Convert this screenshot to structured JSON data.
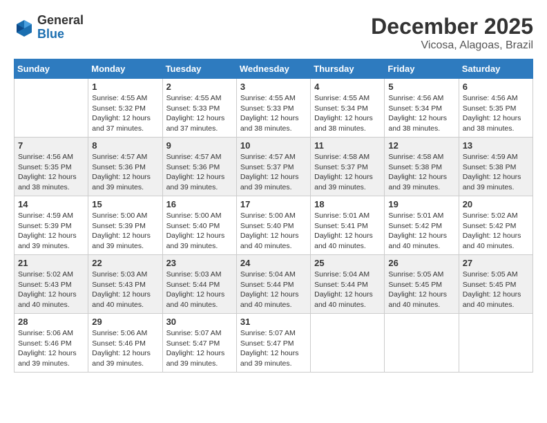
{
  "logo": {
    "general": "General",
    "blue": "Blue"
  },
  "title": "December 2025",
  "location": "Vicosa, Alagoas, Brazil",
  "days_of_week": [
    "Sunday",
    "Monday",
    "Tuesday",
    "Wednesday",
    "Thursday",
    "Friday",
    "Saturday"
  ],
  "weeks": [
    [
      {
        "day": "",
        "info": ""
      },
      {
        "day": "1",
        "info": "Sunrise: 4:55 AM\nSunset: 5:32 PM\nDaylight: 12 hours\nand 37 minutes."
      },
      {
        "day": "2",
        "info": "Sunrise: 4:55 AM\nSunset: 5:33 PM\nDaylight: 12 hours\nand 37 minutes."
      },
      {
        "day": "3",
        "info": "Sunrise: 4:55 AM\nSunset: 5:33 PM\nDaylight: 12 hours\nand 38 minutes."
      },
      {
        "day": "4",
        "info": "Sunrise: 4:55 AM\nSunset: 5:34 PM\nDaylight: 12 hours\nand 38 minutes."
      },
      {
        "day": "5",
        "info": "Sunrise: 4:56 AM\nSunset: 5:34 PM\nDaylight: 12 hours\nand 38 minutes."
      },
      {
        "day": "6",
        "info": "Sunrise: 4:56 AM\nSunset: 5:35 PM\nDaylight: 12 hours\nand 38 minutes."
      }
    ],
    [
      {
        "day": "7",
        "info": "Sunrise: 4:56 AM\nSunset: 5:35 PM\nDaylight: 12 hours\nand 38 minutes."
      },
      {
        "day": "8",
        "info": "Sunrise: 4:57 AM\nSunset: 5:36 PM\nDaylight: 12 hours\nand 39 minutes."
      },
      {
        "day": "9",
        "info": "Sunrise: 4:57 AM\nSunset: 5:36 PM\nDaylight: 12 hours\nand 39 minutes."
      },
      {
        "day": "10",
        "info": "Sunrise: 4:57 AM\nSunset: 5:37 PM\nDaylight: 12 hours\nand 39 minutes."
      },
      {
        "day": "11",
        "info": "Sunrise: 4:58 AM\nSunset: 5:37 PM\nDaylight: 12 hours\nand 39 minutes."
      },
      {
        "day": "12",
        "info": "Sunrise: 4:58 AM\nSunset: 5:38 PM\nDaylight: 12 hours\nand 39 minutes."
      },
      {
        "day": "13",
        "info": "Sunrise: 4:59 AM\nSunset: 5:38 PM\nDaylight: 12 hours\nand 39 minutes."
      }
    ],
    [
      {
        "day": "14",
        "info": "Sunrise: 4:59 AM\nSunset: 5:39 PM\nDaylight: 12 hours\nand 39 minutes."
      },
      {
        "day": "15",
        "info": "Sunrise: 5:00 AM\nSunset: 5:39 PM\nDaylight: 12 hours\nand 39 minutes."
      },
      {
        "day": "16",
        "info": "Sunrise: 5:00 AM\nSunset: 5:40 PM\nDaylight: 12 hours\nand 39 minutes."
      },
      {
        "day": "17",
        "info": "Sunrise: 5:00 AM\nSunset: 5:40 PM\nDaylight: 12 hours\nand 40 minutes."
      },
      {
        "day": "18",
        "info": "Sunrise: 5:01 AM\nSunset: 5:41 PM\nDaylight: 12 hours\nand 40 minutes."
      },
      {
        "day": "19",
        "info": "Sunrise: 5:01 AM\nSunset: 5:42 PM\nDaylight: 12 hours\nand 40 minutes."
      },
      {
        "day": "20",
        "info": "Sunrise: 5:02 AM\nSunset: 5:42 PM\nDaylight: 12 hours\nand 40 minutes."
      }
    ],
    [
      {
        "day": "21",
        "info": "Sunrise: 5:02 AM\nSunset: 5:43 PM\nDaylight: 12 hours\nand 40 minutes."
      },
      {
        "day": "22",
        "info": "Sunrise: 5:03 AM\nSunset: 5:43 PM\nDaylight: 12 hours\nand 40 minutes."
      },
      {
        "day": "23",
        "info": "Sunrise: 5:03 AM\nSunset: 5:44 PM\nDaylight: 12 hours\nand 40 minutes."
      },
      {
        "day": "24",
        "info": "Sunrise: 5:04 AM\nSunset: 5:44 PM\nDaylight: 12 hours\nand 40 minutes."
      },
      {
        "day": "25",
        "info": "Sunrise: 5:04 AM\nSunset: 5:44 PM\nDaylight: 12 hours\nand 40 minutes."
      },
      {
        "day": "26",
        "info": "Sunrise: 5:05 AM\nSunset: 5:45 PM\nDaylight: 12 hours\nand 40 minutes."
      },
      {
        "day": "27",
        "info": "Sunrise: 5:05 AM\nSunset: 5:45 PM\nDaylight: 12 hours\nand 40 minutes."
      }
    ],
    [
      {
        "day": "28",
        "info": "Sunrise: 5:06 AM\nSunset: 5:46 PM\nDaylight: 12 hours\nand 39 minutes."
      },
      {
        "day": "29",
        "info": "Sunrise: 5:06 AM\nSunset: 5:46 PM\nDaylight: 12 hours\nand 39 minutes."
      },
      {
        "day": "30",
        "info": "Sunrise: 5:07 AM\nSunset: 5:47 PM\nDaylight: 12 hours\nand 39 minutes."
      },
      {
        "day": "31",
        "info": "Sunrise: 5:07 AM\nSunset: 5:47 PM\nDaylight: 12 hours\nand 39 minutes."
      },
      {
        "day": "",
        "info": ""
      },
      {
        "day": "",
        "info": ""
      },
      {
        "day": "",
        "info": ""
      }
    ]
  ]
}
